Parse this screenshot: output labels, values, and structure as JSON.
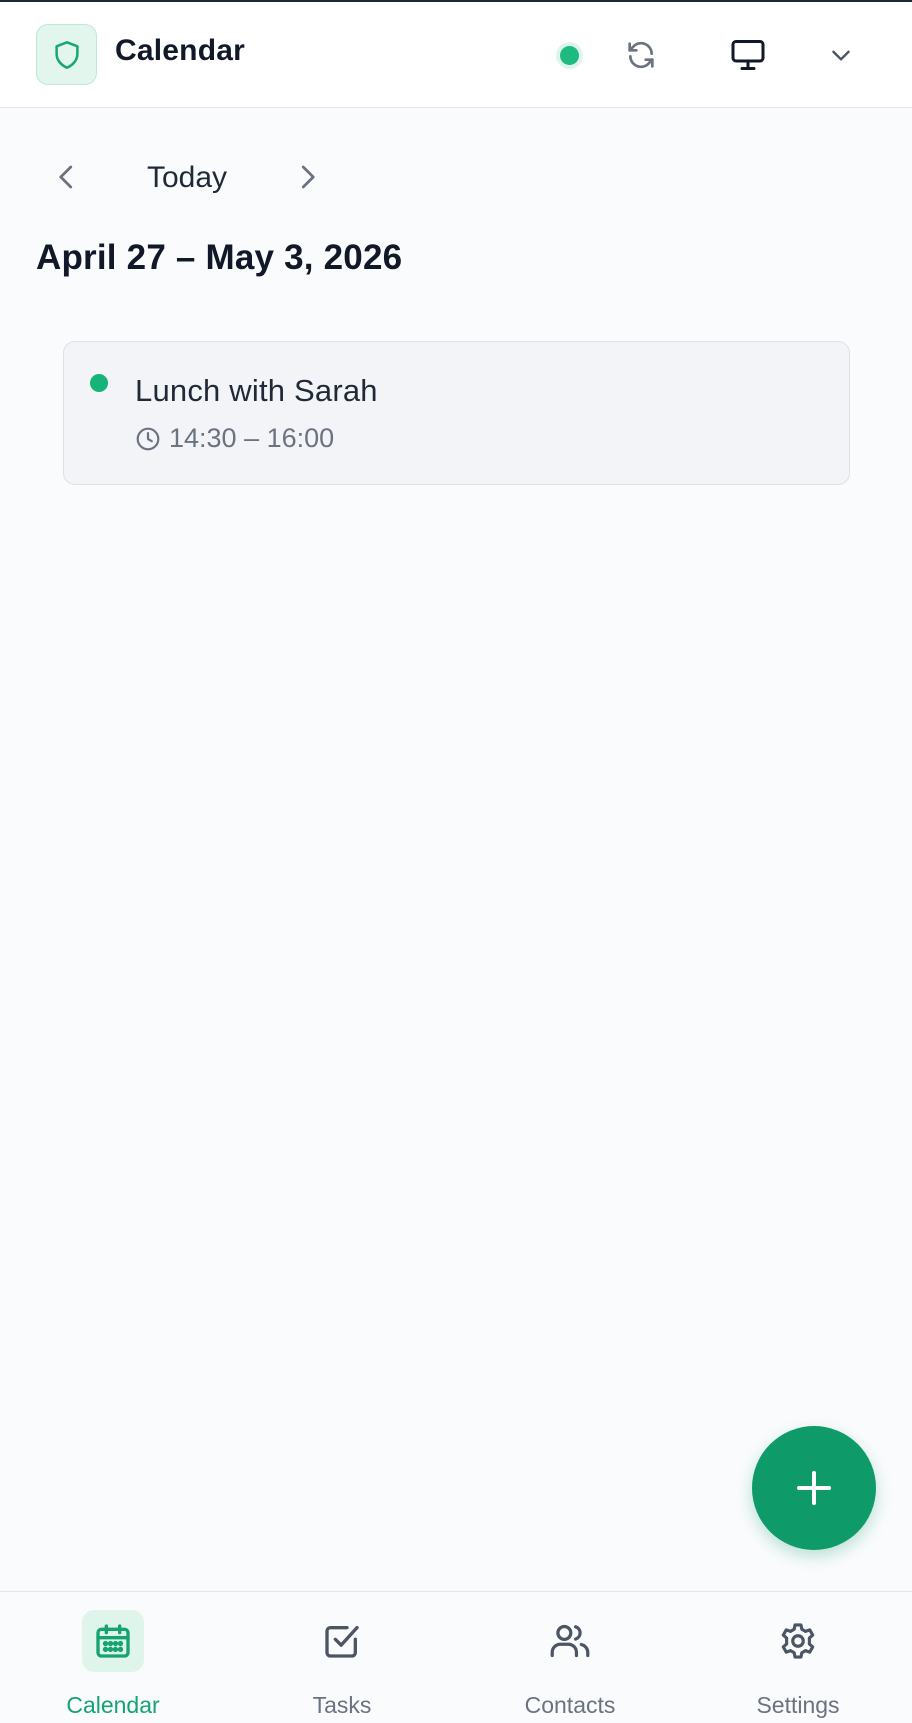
{
  "header": {
    "title": "Calendar",
    "logo_icon": "shield-icon",
    "status": "online",
    "sync_icon": "refresh-icon",
    "device_icon": "monitor-icon",
    "menu_icon": "chevron-down-icon"
  },
  "navigation": {
    "prev_icon": "chevron-left-icon",
    "today_label": "Today",
    "next_icon": "chevron-right-icon",
    "range_title": "April 27 – May 3, 2026"
  },
  "events": [
    {
      "title": "Lunch with Sarah",
      "time": "14:30 – 16:00",
      "color": "#16b47a"
    }
  ],
  "fab": {
    "icon": "plus-icon"
  },
  "bottom_nav": {
    "items": [
      {
        "label": "Calendar",
        "icon": "calendar-icon",
        "active": true
      },
      {
        "label": "Tasks",
        "icon": "checkbox-icon",
        "active": false
      },
      {
        "label": "Contacts",
        "icon": "users-icon",
        "active": false
      },
      {
        "label": "Settings",
        "icon": "gear-icon",
        "active": false
      }
    ]
  },
  "colors": {
    "accent": "#0f9a6a",
    "accent_light": "#dff5ec",
    "status_green": "#1dbb7f",
    "text_primary": "#111827",
    "text_muted": "#6b7280"
  }
}
